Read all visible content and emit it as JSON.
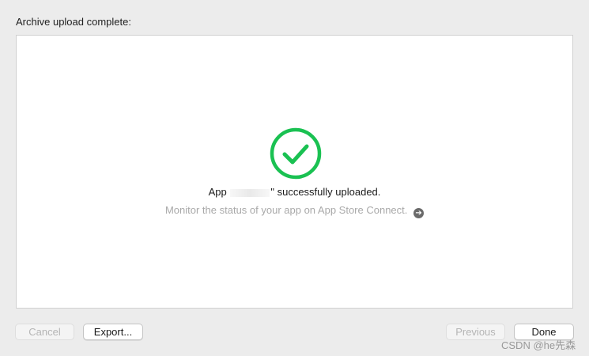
{
  "dialog": {
    "header": "Archive upload complete:"
  },
  "status": {
    "prefix": "App",
    "suffix": "\" successfully uploaded.",
    "monitor_text": "Monitor the status of your app on App Store Connect.",
    "arrow_glyph": "➔",
    "icon": "checkmark-circle-icon",
    "icon_color": "#1ac152"
  },
  "buttons": {
    "cancel": "Cancel",
    "export": "Export...",
    "previous": "Previous",
    "done": "Done"
  },
  "watermark": "CSDN @he先森"
}
